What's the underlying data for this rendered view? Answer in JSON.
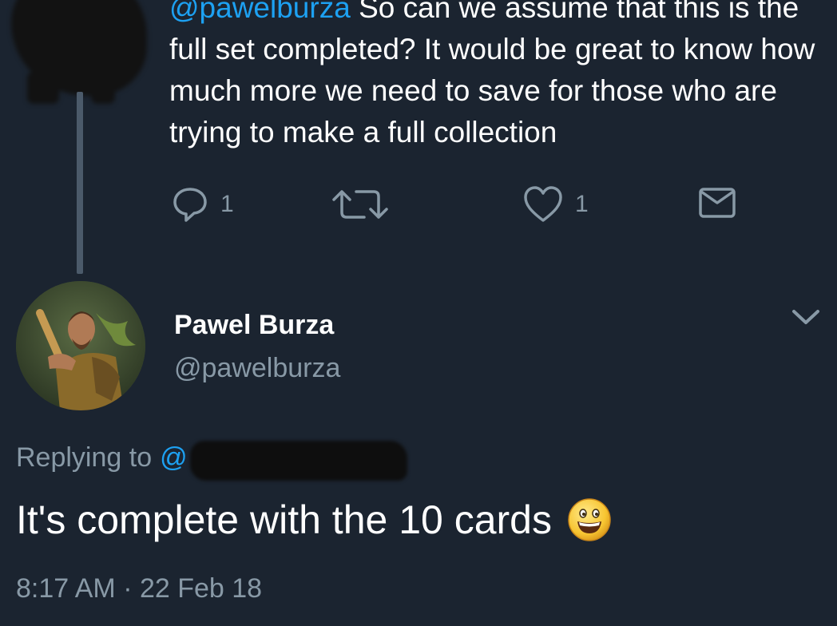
{
  "parent_tweet": {
    "mention": "@pawelburza",
    "text": "So can we assume that this is the full set completed? It would be great to know how much more we need to save for those who are trying to make a full collection",
    "actions": {
      "reply_count": "1",
      "like_count": "1"
    }
  },
  "reply_tweet": {
    "display_name": "Pawel Burza",
    "handle": "@pawelburza",
    "replying_to_label": "Replying to",
    "replying_to_mention": "@",
    "text": "It's complete with the 10 cards",
    "emoji": "grinning-face-emoji",
    "timestamp": "8:17 AM · 22 Feb 18"
  },
  "colors": {
    "background": "#1b2430",
    "link": "#1da1f2",
    "muted": "#8899a6",
    "thread_line": "#4b5a6a"
  }
}
